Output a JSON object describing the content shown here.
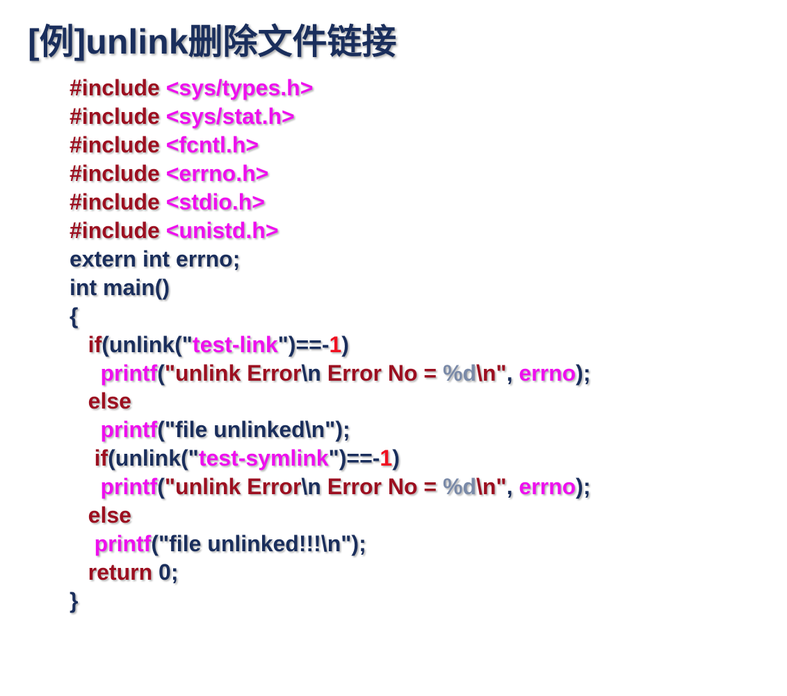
{
  "title": "[例]unlink删除文件链接",
  "code": {
    "l0a": "#include ",
    "l0b": "<sys/types.h>",
    "l1a": "#include ",
    "l1b": "<sys/stat.h>",
    "l2a": "#include ",
    "l2b": "<fcntl.h>",
    "l3a": "#include ",
    "l3b": "<errno.h>",
    "l4a": "#include ",
    "l4b": "<stdio.h>",
    "l5a": "#include ",
    "l5b": "<unistd.h>",
    "l6": "extern int errno;",
    "l7": "int main()",
    "l8": "{",
    "l9_pad": "   ",
    "l9_if": "if",
    "l9_a": "(unlink(\"",
    "l9_b": "test-link",
    "l9_c": "\")==-",
    "l9_d": "1",
    "l9_e": ")",
    "l10_pad": "     ",
    "l10_a": "printf",
    "l10_b": "(",
    "l10_c": "\"unlink Error",
    "l10_d": "\\n",
    "l10_e": " Error No = ",
    "l10_f": "%d",
    "l10_g": "\\n\"",
    "l10_h": ", ",
    "l10_i": "errno",
    "l10_j": ");",
    "l11_pad": "   ",
    "l11": "else",
    "l12_pad": "     ",
    "l12_a": "printf",
    "l12_b": "(",
    "l12_c": "\"file unlinked",
    "l12_d": "\\n\"",
    "l12_e": ");",
    "l13_pad": "    ",
    "l13_if": "if",
    "l13_a": "(unlink(\"",
    "l13_b": "test-symlink",
    "l13_c": "\")==-",
    "l13_d": "1",
    "l13_e": ")",
    "l14_pad": "     ",
    "l14_a": "printf",
    "l14_b": "(",
    "l14_c": "\"unlink Error",
    "l14_d": "\\n",
    "l14_e": " Error No = ",
    "l14_f": "%d",
    "l14_g": "\\n\"",
    "l14_h": ", ",
    "l14_i": "errno",
    "l14_j": ");",
    "l15_pad": "   ",
    "l15": "else",
    "l16_pad": "    ",
    "l16_a": "printf",
    "l16_b": "(",
    "l16_c": "\"file unlinked!!!",
    "l16_d": "\\n\"",
    "l16_e": ");",
    "l17_pad": "   ",
    "l17_a": "return ",
    "l17_b": "0",
    "l17_c": ";",
    "l18": "}"
  }
}
